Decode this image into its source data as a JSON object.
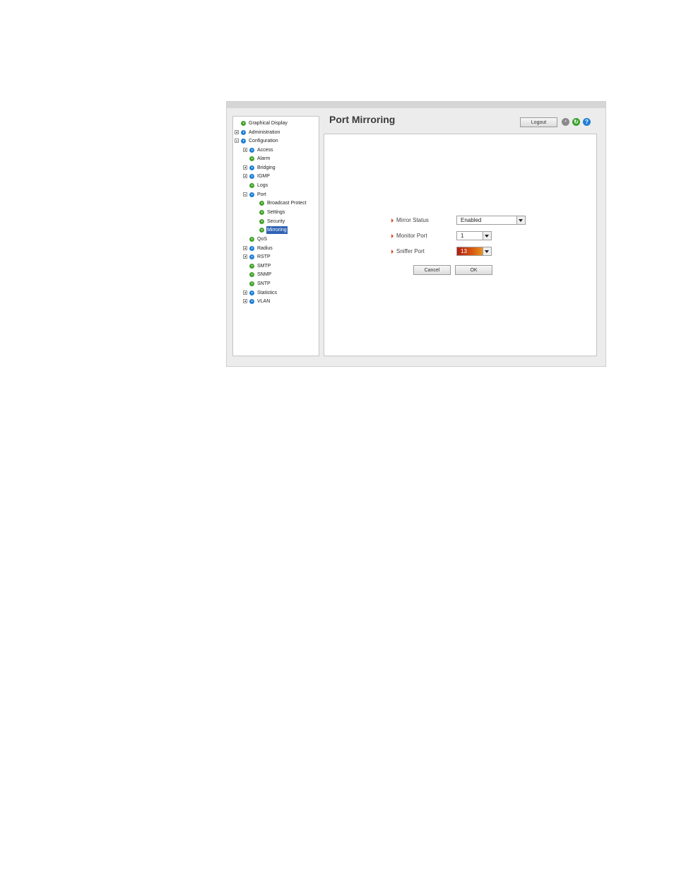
{
  "page": {
    "title": "Port Mirroring"
  },
  "header": {
    "logout_label": "Logout",
    "icons": [
      "save-icon",
      "refresh-icon",
      "help-icon"
    ]
  },
  "sidebar": {
    "items": [
      {
        "label": "Graphical Display"
      },
      {
        "label": "Administration",
        "toggle": "plus"
      },
      {
        "label": "Configuration",
        "toggle": "minus"
      },
      {
        "label": "Access",
        "toggle": "plus"
      },
      {
        "label": "Alarm"
      },
      {
        "label": "Bridging",
        "toggle": "plus"
      },
      {
        "label": "IGMP",
        "toggle": "plus"
      },
      {
        "label": "Logs"
      },
      {
        "label": "Port",
        "toggle": "minus"
      },
      {
        "label": "Broadcast Protect"
      },
      {
        "label": "Settings"
      },
      {
        "label": "Security"
      },
      {
        "label": "Mirroring",
        "selected": true
      },
      {
        "label": "QoS"
      },
      {
        "label": "Radius",
        "toggle": "plus"
      },
      {
        "label": "RSTP",
        "toggle": "plus"
      },
      {
        "label": "SMTP"
      },
      {
        "label": "SNMP"
      },
      {
        "label": "SNTP"
      },
      {
        "label": "Statistics",
        "toggle": "plus"
      },
      {
        "label": "VLAN",
        "toggle": "plus"
      }
    ]
  },
  "form": {
    "mirror_status": {
      "label": "Mirror Status",
      "value": "Enabled"
    },
    "monitor_port": {
      "label": "Monitor Port",
      "value": "1"
    },
    "sniffer_port": {
      "label": "Sniffer Port",
      "value": "13"
    },
    "cancel_label": "Cancel",
    "ok_label": "OK"
  },
  "colors": {
    "selected_bg": "#2f63b5",
    "node_blue": "#1f7fd6",
    "node_green": "#44a22b",
    "accent_arrow": "#d14a1a"
  }
}
